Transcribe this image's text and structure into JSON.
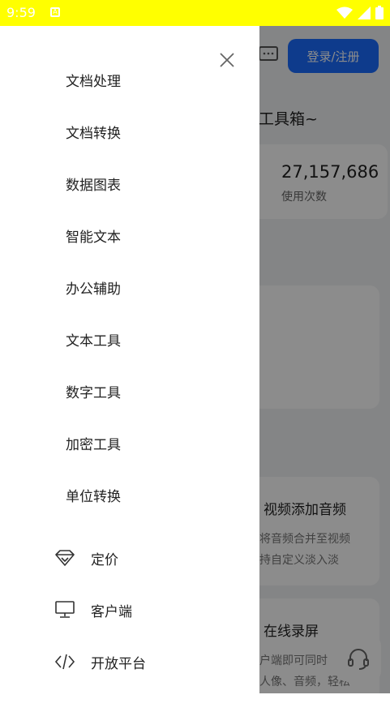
{
  "status_bar": {
    "time": "9:59",
    "notification": "A"
  },
  "background": {
    "login_button": "登录/注册",
    "slogan": "线工具箱~",
    "stats": {
      "number": "27,157,686",
      "label": "使用次数"
    },
    "card1": {
      "title": "视频添加音频",
      "desc_line1": "将音频合并至视频",
      "desc_line2": "持自定义淡入淡"
    },
    "card2": {
      "title": "在线录屏",
      "desc_line1": "户端即可同时",
      "desc_line2": "人像、音频，轻松"
    }
  },
  "drawer": {
    "menu_items": [
      {
        "label": "文档处理"
      },
      {
        "label": "文档转换"
      },
      {
        "label": "数据图表"
      },
      {
        "label": "智能文本"
      },
      {
        "label": "办公辅助"
      },
      {
        "label": "文本工具"
      },
      {
        "label": "数字工具"
      },
      {
        "label": "加密工具"
      },
      {
        "label": "单位转换"
      }
    ],
    "icon_items": [
      {
        "label": "定价",
        "icon": "diamond-icon"
      },
      {
        "label": "客户端",
        "icon": "monitor-icon"
      },
      {
        "label": "开放平台",
        "icon": "code-icon"
      }
    ]
  },
  "colors": {
    "status_bar": "#ffff00",
    "accent": "#1a6cff",
    "text": "#222222"
  }
}
